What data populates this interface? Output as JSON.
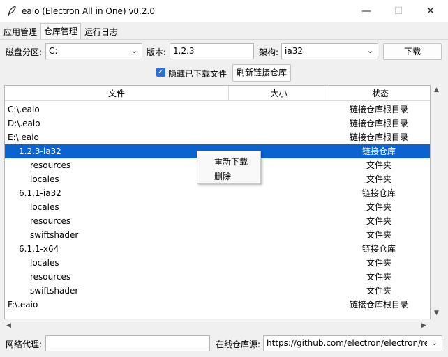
{
  "window": {
    "title": "eaio (Electron All in One) v0.2.0",
    "icon": "feather-icon"
  },
  "tabs": [
    {
      "label": "应用管理",
      "active": false
    },
    {
      "label": "仓库管理",
      "active": true
    },
    {
      "label": "运行日志",
      "active": false
    }
  ],
  "toolbar": {
    "disk_label": "磁盘分区:",
    "disk_value": "C:",
    "version_label": "版本:",
    "version_value": "1.2.3",
    "arch_label": "架构:",
    "arch_value": "ia32",
    "download_button": "下载",
    "hide_downloaded_label": "隐藏已下载文件",
    "hide_downloaded_checked": true,
    "refresh_button": "刷新链接仓库"
  },
  "tree": {
    "columns": [
      "文件",
      "大小",
      "状态"
    ],
    "rows": [
      {
        "name": "C:\\.eaio",
        "size": "",
        "status": "链接仓库根目录",
        "level": 0,
        "selected": false
      },
      {
        "name": "D:\\.eaio",
        "size": "",
        "status": "链接仓库根目录",
        "level": 0,
        "selected": false
      },
      {
        "name": "E:\\.eaio",
        "size": "",
        "status": "链接仓库根目录",
        "level": 0,
        "selected": false
      },
      {
        "name": "1.2.3-ia32",
        "size": "",
        "status": "链接仓库",
        "level": 1,
        "selected": true
      },
      {
        "name": "resources",
        "size": "",
        "status": "文件夹",
        "level": 2,
        "selected": false
      },
      {
        "name": "locales",
        "size": "",
        "status": "文件夹",
        "level": 2,
        "selected": false
      },
      {
        "name": "6.1.1-ia32",
        "size": "",
        "status": "链接仓库",
        "level": 1,
        "selected": false
      },
      {
        "name": "locales",
        "size": "",
        "status": "文件夹",
        "level": 2,
        "selected": false
      },
      {
        "name": "resources",
        "size": "",
        "status": "文件夹",
        "level": 2,
        "selected": false
      },
      {
        "name": "swiftshader",
        "size": "",
        "status": "文件夹",
        "level": 2,
        "selected": false
      },
      {
        "name": "6.1.1-x64",
        "size": "",
        "status": "链接仓库",
        "level": 1,
        "selected": false
      },
      {
        "name": "locales",
        "size": "",
        "status": "文件夹",
        "level": 2,
        "selected": false
      },
      {
        "name": "resources",
        "size": "",
        "status": "文件夹",
        "level": 2,
        "selected": false
      },
      {
        "name": "swiftshader",
        "size": "",
        "status": "文件夹",
        "level": 2,
        "selected": false
      },
      {
        "name": "F:\\.eaio",
        "size": "",
        "status": "链接仓库根目录",
        "level": 0,
        "selected": false
      }
    ]
  },
  "context_menu": {
    "items": [
      "重新下载",
      "删除"
    ]
  },
  "bottom": {
    "proxy_label": "网络代理:",
    "proxy_value": "",
    "source_label": "在线仓库源:",
    "source_value": "https://github.com/electron/electron/rele"
  },
  "colors": {
    "selection": "#0a63cf",
    "checkbox": "#2b6fd6",
    "background": "#f0f0f0"
  }
}
